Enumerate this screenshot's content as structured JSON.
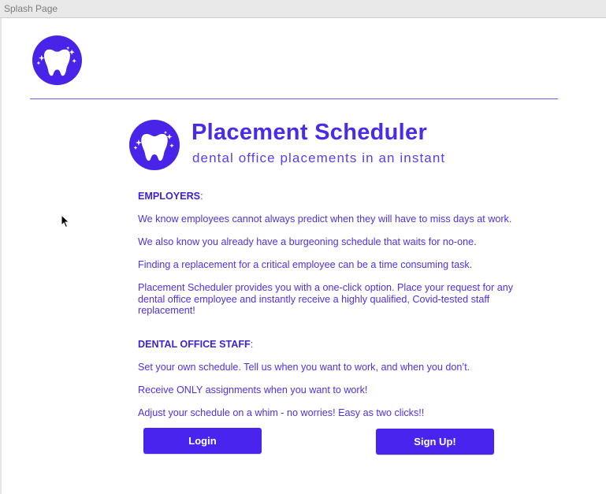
{
  "window": {
    "title": "Splash Page"
  },
  "brand": {
    "title": "Placement Scheduler",
    "subtitle": "dental office placements in an instant",
    "accent_color": "#4a2bea"
  },
  "employers": {
    "heading": "EMPLOYERS",
    "colon": ":",
    "paragraphs": [
      "We know employees cannot always predict when they will have to miss days at work.",
      "We also know you already have a burgeoning schedule that waits for no-one.",
      "Finding a replacement for a critical employee can be a time consuming task.",
      "Placement Scheduler provides you with a one-click option.  Place your request for any dental office employee and instantly receive a highly qualified, Covid-tested staff replacement!"
    ]
  },
  "staff": {
    "heading": "DENTAL OFFICE STAFF",
    "colon": ":",
    "paragraphs": [
      "Set your own schedule.  Tell us when you want to work, and when you don’t.",
      "Receive ONLY assignments when you want to work!",
      "Adjust your schedule on a whim - no worries!  Easy as two clicks!!"
    ]
  },
  "buttons": {
    "login": "Login",
    "signup": "Sign Up!"
  },
  "icons": {
    "logo": "tooth-sparkle-icon",
    "cursor": "mouse-pointer-icon"
  }
}
